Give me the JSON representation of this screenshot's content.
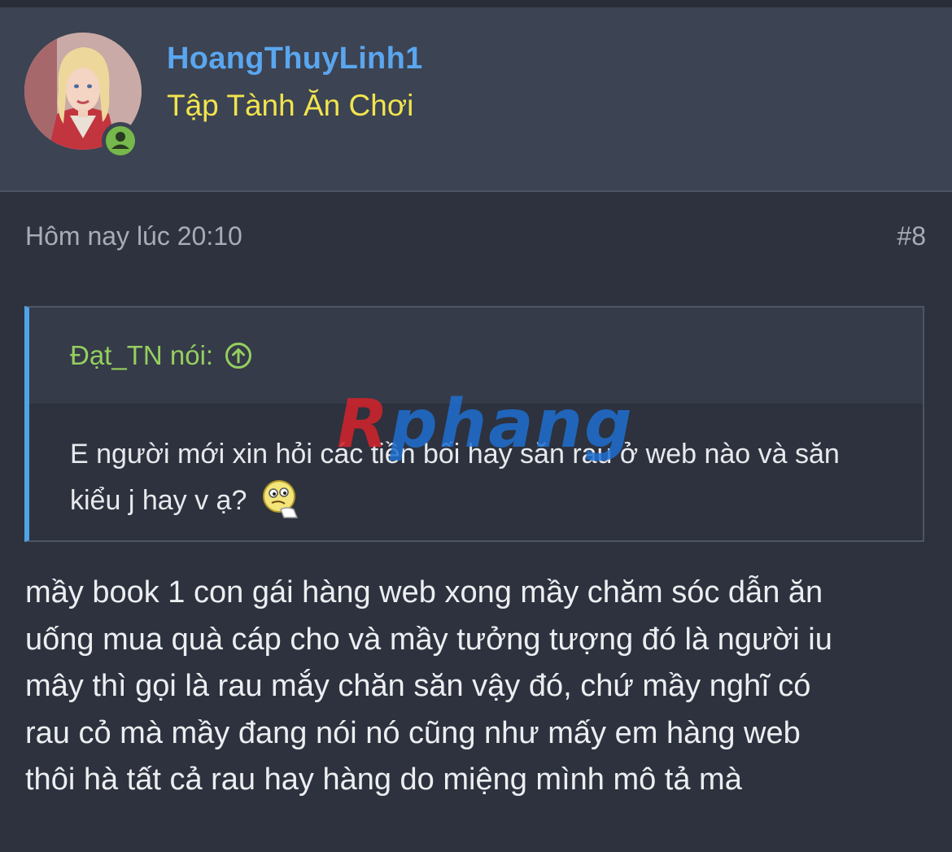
{
  "user": {
    "username": "HoangThuyLinh1",
    "title": "Tập Tành Ăn Chơi",
    "avatar_icon": "user-avatar",
    "status_icon": "online-user-icon",
    "status_color": "#76b84b"
  },
  "post": {
    "date": "Hôm nay lúc 20:10",
    "number": "#8"
  },
  "quote": {
    "author_label": "Đạt_TN nói:",
    "jump_icon": "arrow-up-circle-icon",
    "text": "E người mới xin hỏi các tiền bối hay săn rau ở web nào và săn kiểu j hay v ạ?",
    "emoji_icon": "thinking-emoji"
  },
  "watermark": {
    "text_red": "R",
    "text_blue": "phang"
  },
  "body": {
    "lines": [
      "mầy book 1 con gái hàng web xong mầy chăm sóc dẫn ăn",
      "uống mua quà cáp cho và mầy tưởng tượng đó là người iu",
      "mây thì gọi là rau mắy chăn săn vậy đó, chứ mầy nghĩ có",
      "rau cỏ mà mầy đang nói nó cũng như mấy em hàng web",
      "thôi hà tất cả rau hay hàng do miệng mình mô tả mà"
    ]
  },
  "colors": {
    "username": "#5aa6ef",
    "title": "#f1e44e",
    "quote_author": "#95cf5f",
    "quote_border": "#4fa3e6",
    "background": "#2d323e",
    "header_bg": "#3c4352"
  }
}
